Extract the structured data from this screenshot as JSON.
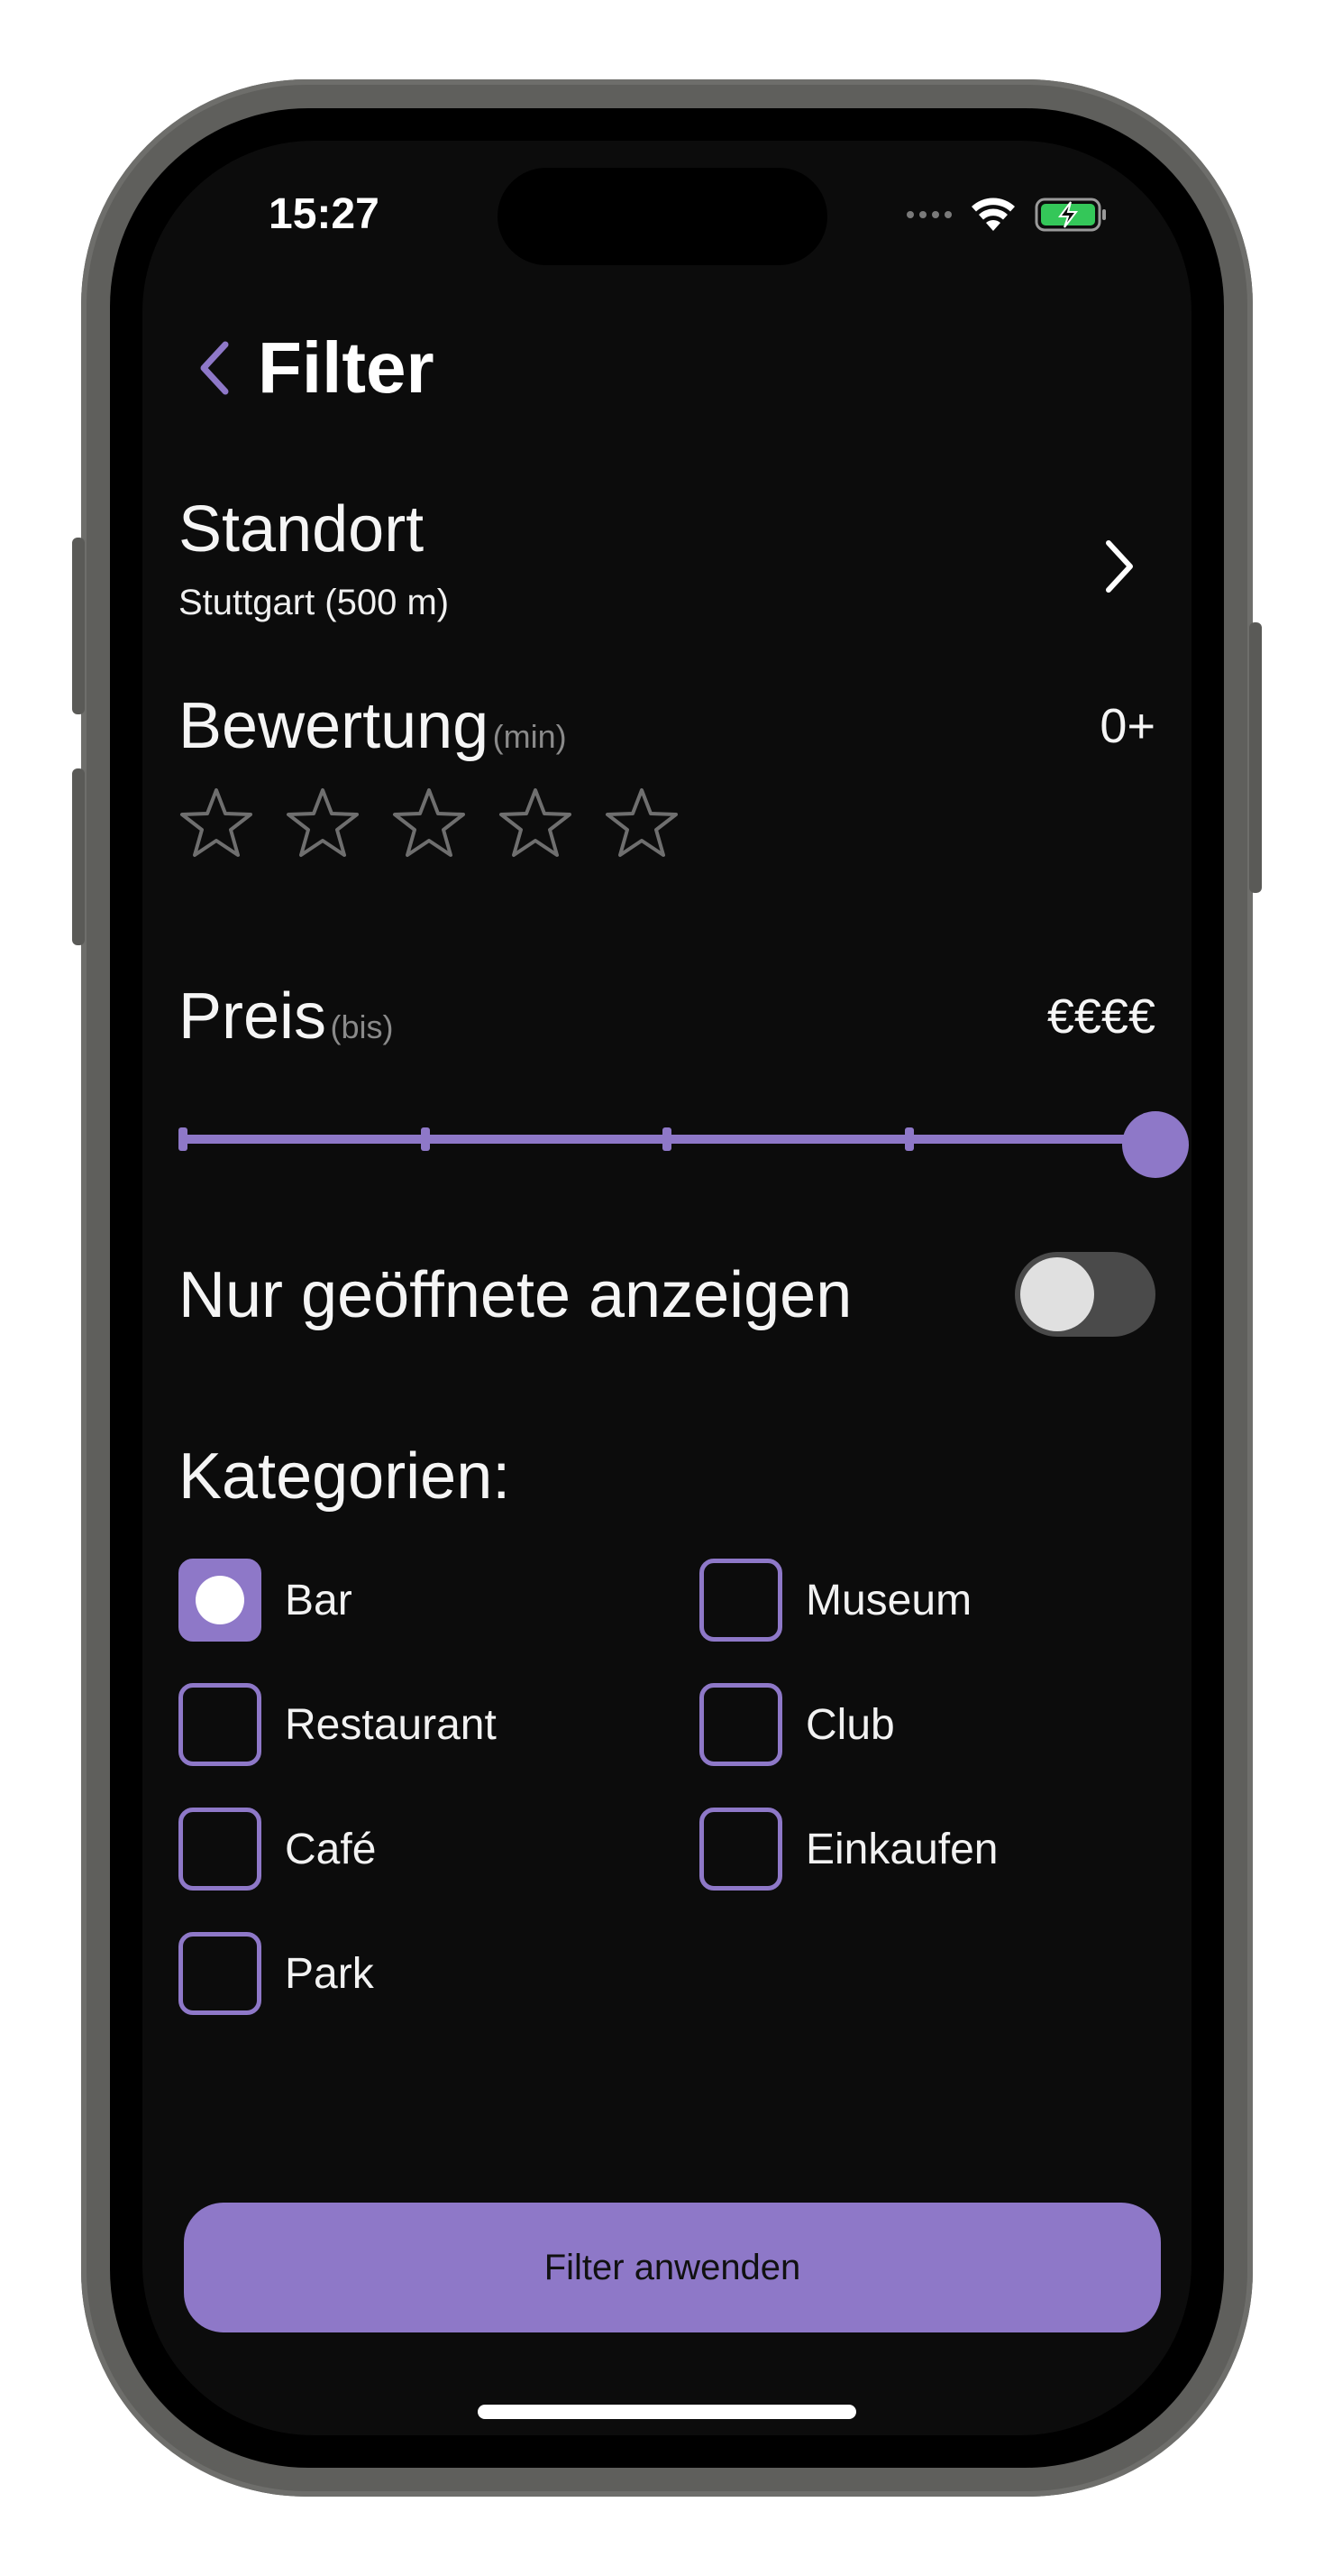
{
  "status_bar": {
    "time": "15:27",
    "battery_color": "#34c759"
  },
  "nav": {
    "title": "Filter"
  },
  "location": {
    "title": "Standort",
    "value": "Stuttgart (500 m)"
  },
  "rating": {
    "title": "Bewertung",
    "note": "(min)",
    "value": "0+",
    "stars_total": 5,
    "stars_selected": 0
  },
  "price": {
    "title": "Preis",
    "note": "(bis)",
    "value": "€€€€",
    "steps": 5,
    "selected_step": 5
  },
  "open_only": {
    "label": "Nur geöffnete anzeigen",
    "enabled": false
  },
  "categories": {
    "title": "Kategorien:",
    "items": [
      {
        "label": "Bar",
        "checked": true
      },
      {
        "label": "Museum",
        "checked": false
      },
      {
        "label": "Restaurant",
        "checked": false
      },
      {
        "label": "Club",
        "checked": false
      },
      {
        "label": "Café",
        "checked": false
      },
      {
        "label": "Einkaufen",
        "checked": false
      },
      {
        "label": "Park",
        "checked": false
      }
    ]
  },
  "apply_button": {
    "label": "Filter anwenden"
  },
  "colors": {
    "accent": "#8e78c8",
    "background": "#0c0c0c"
  }
}
